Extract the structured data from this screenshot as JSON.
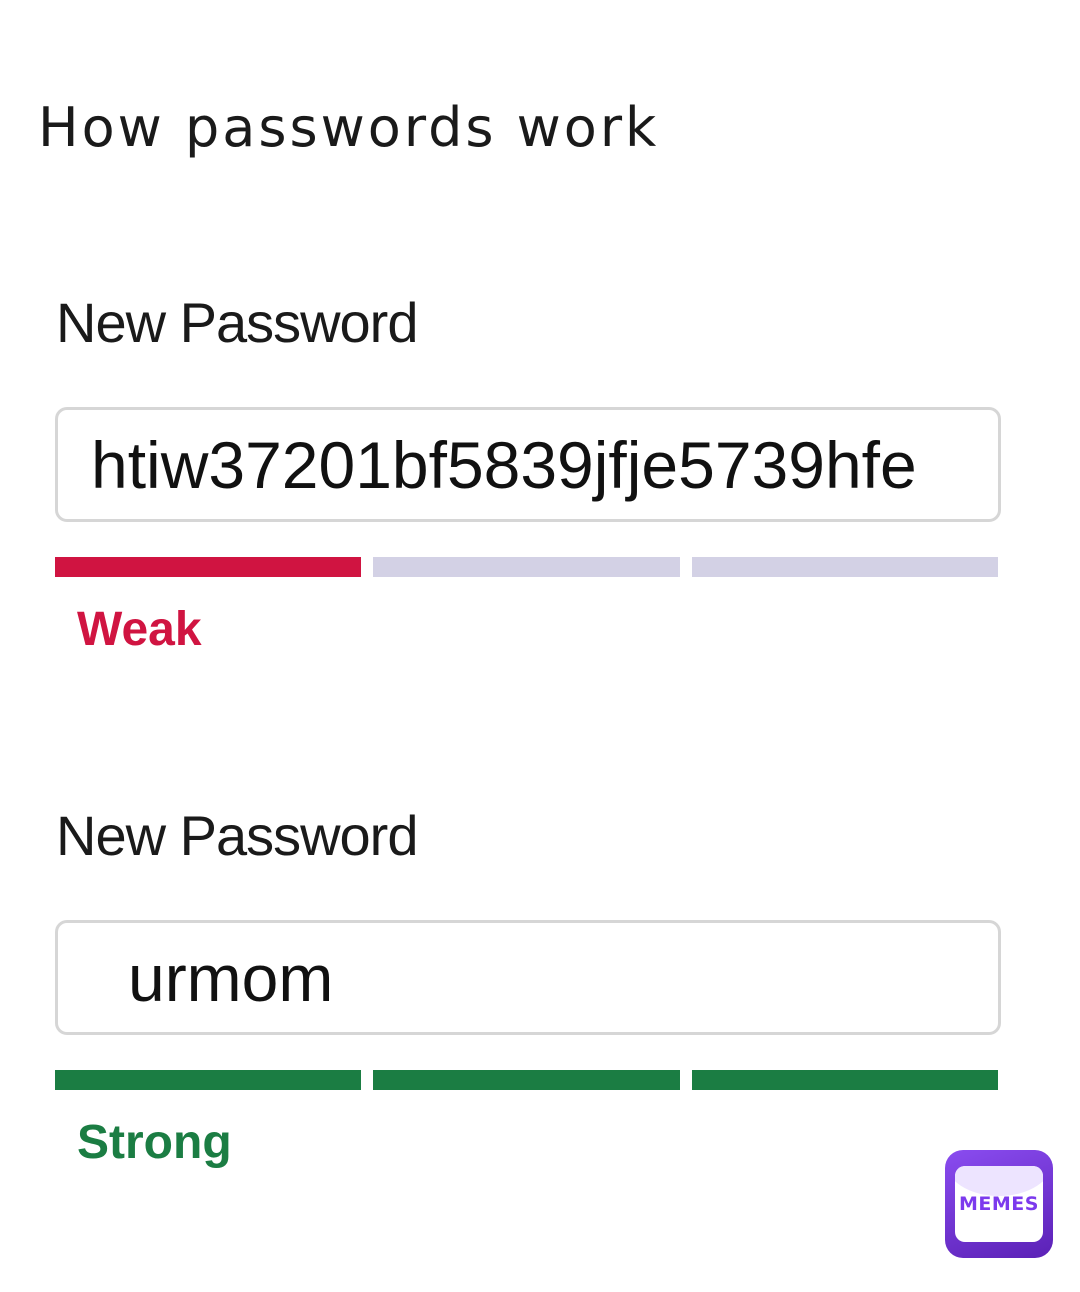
{
  "caption": "How passwords work",
  "colors": {
    "weak": "#d01441",
    "strong": "#1b7d43",
    "inactive": "#d3d1e5",
    "watermark": "#7c3aed"
  },
  "fields": [
    {
      "label": "New Password",
      "value": "htiw37201bf5839jfje5739hfe",
      "strength": "Weak",
      "meter_filled": 1,
      "meter_total": 3
    },
    {
      "label": "New Password",
      "value": "urmom",
      "strength": "Strong",
      "meter_filled": 3,
      "meter_total": 3
    }
  ],
  "watermark": {
    "text": "MEMES",
    "icon": "envelope-icon"
  }
}
